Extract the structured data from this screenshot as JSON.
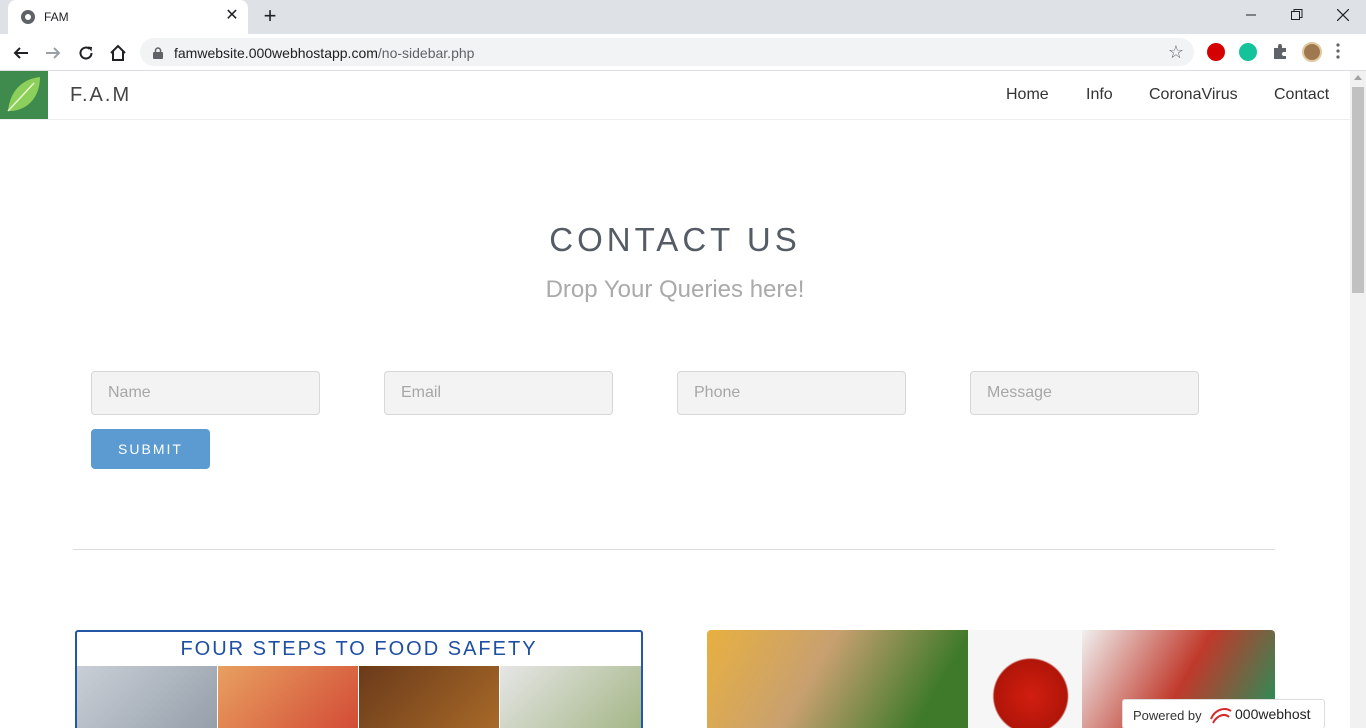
{
  "browser": {
    "tab_title": "FAM",
    "url_host": "famwebsite.000webhostapp.com",
    "url_path": "/no-sidebar.php"
  },
  "site": {
    "brand": "F.A.M",
    "nav": [
      "Home",
      "Info",
      "CoronaVirus",
      "Contact"
    ]
  },
  "contact": {
    "title": "CONTACT US",
    "subtitle": "Drop Your Queries here!",
    "fields": {
      "name_placeholder": "Name",
      "email_placeholder": "Email",
      "phone_placeholder": "Phone",
      "message_placeholder": "Message"
    },
    "submit_label": "SUBMIT"
  },
  "poster": {
    "title": "FOUR STEPS TO FOOD SAFETY"
  },
  "badge": {
    "text": "Powered by",
    "brand": "000webhost"
  },
  "colors": {
    "accent": "#5b9bd1",
    "logo_green": "#3f8a4d",
    "poster_blue": "#1f4fa3"
  }
}
